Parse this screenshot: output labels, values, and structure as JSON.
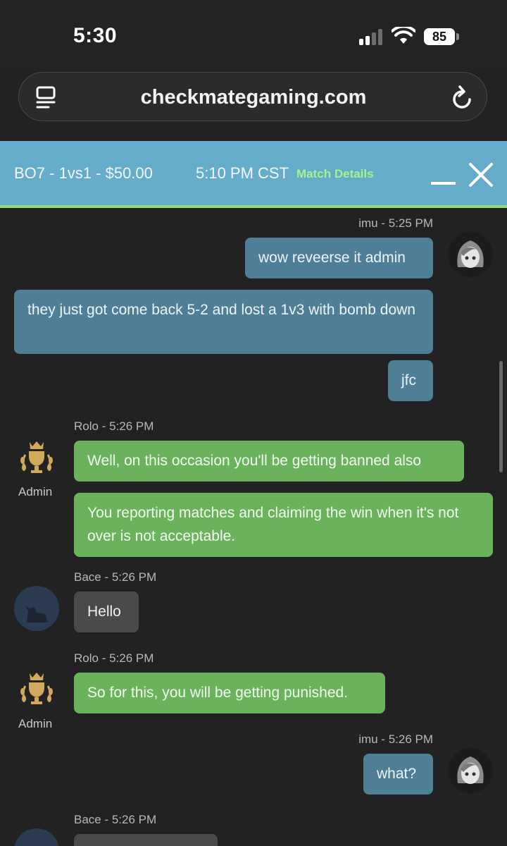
{
  "status_bar": {
    "time": "5:30",
    "battery": "85"
  },
  "browser": {
    "url": "checkmategaming.com"
  },
  "match": {
    "title": "BO7 - 1vs1 - $50.00",
    "time": "5:10 PM CST",
    "details_link": "Match Details"
  },
  "messages": [
    {
      "meta": "imu - 5:25 PM",
      "text": "wow reveerse it admin"
    },
    {
      "text": "they just got come back 5-2 and lost a 1v3 with bomb down"
    },
    {
      "text": "jfc"
    },
    {
      "meta": "Rolo - 5:26 PM",
      "badge": "Admin",
      "text": "Well, on this occasion you'll be getting banned also"
    },
    {
      "text": "You reporting matches and claiming the win when it's not over is not acceptable."
    },
    {
      "meta": "Bace - 5:26 PM",
      "text": "Hello"
    },
    {
      "meta": "Rolo - 5:26 PM",
      "badge": "Admin",
      "text": "So for this, you will be getting punished."
    },
    {
      "meta": "imu - 5:26 PM",
      "text": "what?"
    },
    {
      "meta": "Bace - 5:26 PM",
      "text": ""
    }
  ],
  "colors": {
    "header_bg": "#64acc9",
    "accent_green": "#8fe07a",
    "own_bubble": "#4f7f96",
    "admin_bubble": "#6ab25c",
    "other_bubble": "#4a4a4a"
  }
}
